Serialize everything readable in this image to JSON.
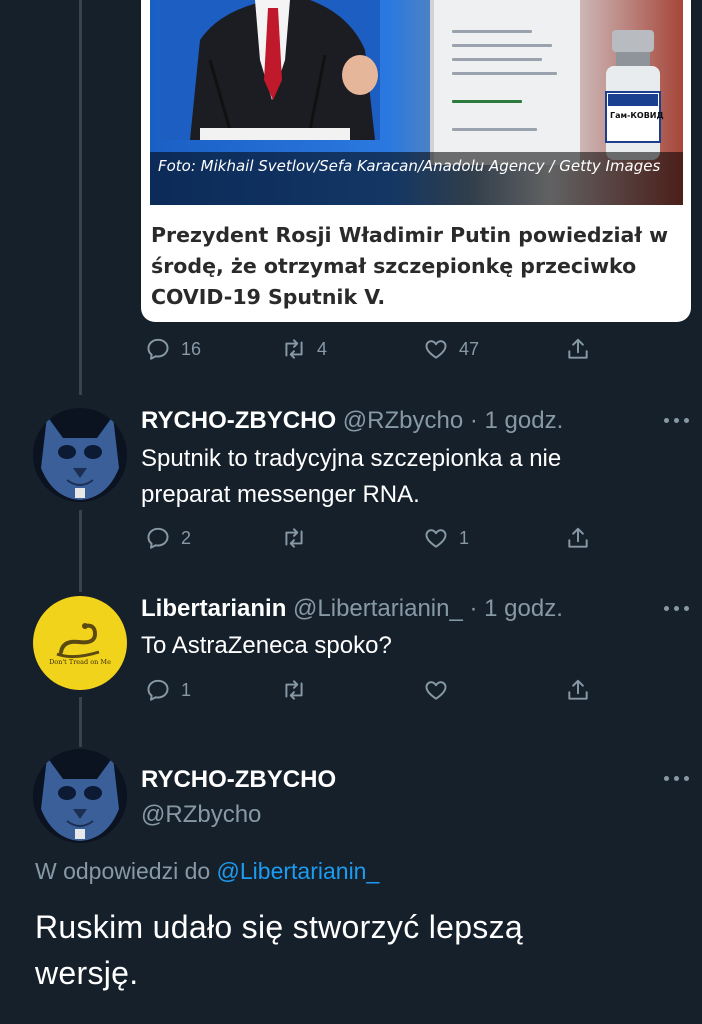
{
  "card": {
    "image_caption": "Foto: Mikhail Svetlov/Sefa Karacan/Anadolu Agency / Getty Images",
    "vial_label": "Гам-КОВИД-Вак",
    "title": "Prezydent Rosji Władimir Putin powiedział w środę, że otrzymał szczepionkę przeciwko COVID-19 Sputnik V."
  },
  "tweet0_actions": {
    "replies": "16",
    "retweets": "4",
    "likes": "47"
  },
  "reply1": {
    "name": "RYCHO-ZBYCHO",
    "handle_time": "@RZbycho · 1 godz.",
    "text": "Sputnik to tradycyjna szczepionka a nie preparat messenger RNA.",
    "replies": "2",
    "likes": "1"
  },
  "reply2": {
    "name": "Libertarianin",
    "handle_time": "@Libertarianin_ · 1 godz.",
    "text": "To AstraZeneca spoko?",
    "avatar_text": "Don't Tread on Me",
    "replies": "1"
  },
  "main": {
    "name": "RYCHO-ZBYCHO",
    "handle": "@RZbycho",
    "reply_to_prefix": "W odpowiedzi do",
    "reply_to_user": "@Libertarianin_",
    "text": "Ruskim udało się stworzyć lepszą wersję."
  },
  "colors": {
    "background": "#15202b",
    "text_muted": "#8899a6",
    "link": "#1d9bf0",
    "thread_line": "#38444d",
    "gadsden_yellow": "#f2d31b"
  },
  "icons": [
    "reply-icon",
    "retweet-icon",
    "like-icon",
    "share-icon",
    "more-icon"
  ]
}
